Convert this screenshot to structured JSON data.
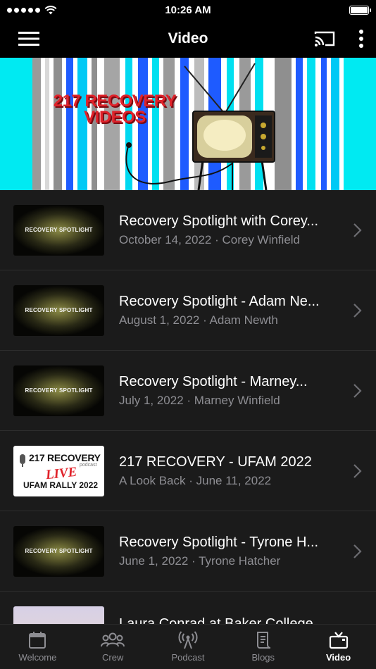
{
  "status_bar": {
    "time": "10:26 AM"
  },
  "nav": {
    "title": "Video"
  },
  "banner": {
    "line1": "217 RECOVERY",
    "line2": "VIDEOS"
  },
  "videos": [
    {
      "title": "Recovery Spotlight with Corey...",
      "subtitle": "October 14, 2022 · Corey Winfield",
      "thumb_text": "RECOVERY SPOTLIGHT"
    },
    {
      "title": "Recovery Spotlight - Adam Ne...",
      "subtitle": "August 1, 2022 · Adam Newth",
      "thumb_text": "RECOVERY SPOTLIGHT"
    },
    {
      "title": "Recovery Spotlight - Marney...",
      "subtitle": "July 1, 2022 · Marney Winfield",
      "thumb_text": "RECOVERY SPOTLIGHT"
    },
    {
      "title": "217 RECOVERY - UFAM 2022",
      "subtitle": "A Look Back · June 11, 2022",
      "thumb_brand": "217 RECOVERY",
      "thumb_podcast": "podcast",
      "thumb_live": "LIVE",
      "thumb_rally": "UFAM RALLY 2022"
    },
    {
      "title": "Recovery Spotlight - Tyrone H...",
      "subtitle": "June 1, 2022 · Tyrone Hatcher",
      "thumb_text": "RECOVERY SPOTLIGHT"
    },
    {
      "title": "Laura Conrad at Baker College",
      "subtitle": ""
    }
  ],
  "tabs": [
    {
      "label": "Welcome",
      "icon": "calendar-icon"
    },
    {
      "label": "Crew",
      "icon": "people-icon"
    },
    {
      "label": "Podcast",
      "icon": "broadcast-icon"
    },
    {
      "label": "Blogs",
      "icon": "document-icon"
    },
    {
      "label": "Video",
      "icon": "tv-icon"
    }
  ],
  "colors": {
    "background": "#000000",
    "list_bg": "#1b1b1b",
    "subtitle": "#8e8e93",
    "banner_red": "#e0222a",
    "banner_cyan": "#00eaf2"
  }
}
